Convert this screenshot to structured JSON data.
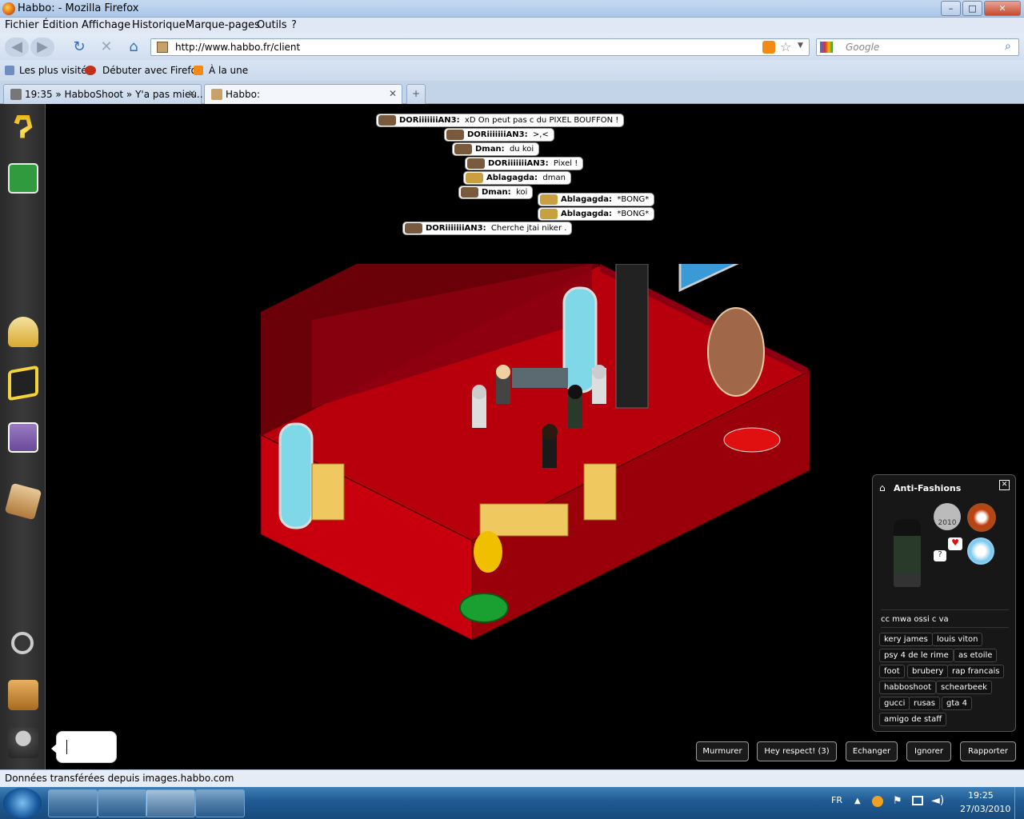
{
  "window": {
    "title": "Habbo: - Mozilla Firefox",
    "min": "–",
    "max": "□",
    "close": "✕"
  },
  "menu": [
    "Fichier",
    "Édition",
    "Affichage",
    "Historique",
    "Marque-pages",
    "Outils",
    "?"
  ],
  "nav": {
    "url": "http://www.habbo.fr/client",
    "search_placeholder": "Google"
  },
  "bookmarks": [
    "Les plus visités",
    "Débuter avec Firefox",
    "À la une"
  ],
  "tabs": [
    {
      "label": "19:35 » HabboShoot » Y'a pas mieu...",
      "close": "✕"
    },
    {
      "label": "Habbo:",
      "close": "✕"
    }
  ],
  "new_tab": "+",
  "chat": [
    {
      "name": "DORiiiiiiiAN3:",
      "text": "xD On peut pas c du PIXEL BOUFFON !"
    },
    {
      "name": "DORiiiiiiiAN3:",
      "text": ">,<"
    },
    {
      "name": "Dman:",
      "text": "du koi"
    },
    {
      "name": "DORiiiiiiiAN3:",
      "text": "Pixel !"
    },
    {
      "name": "Ablagagda:",
      "text": "dman"
    },
    {
      "name": "Dman:",
      "text": "koi"
    },
    {
      "name": "Ablagagda:",
      "text": "*BONG*"
    },
    {
      "name": "Ablagagda:",
      "text": "*BONG*"
    },
    {
      "name": "DORiiiiiiiAN3:",
      "text": "Cherche jtai niker ."
    }
  ],
  "profile": {
    "name": "Anti-Fashions",
    "close": "✕",
    "badge_year": "2010",
    "motto": "cc mwa ossi c va",
    "tags": [
      "kery james",
      "louis viton",
      "psy 4 de le rime",
      "as etoile",
      "foot",
      "brubery",
      "rap francais",
      "habboshoot",
      "schearbeek",
      "gucci",
      "rusas",
      "gta 4",
      "amigo de staff"
    ]
  },
  "actions": [
    "Murmurer",
    "Hey respect! (3)",
    "Echanger",
    "Ignorer",
    "Rapporter"
  ],
  "status": "Données transférées depuis images.habbo.com",
  "taskbar": {
    "lang": "FR",
    "time": "19:25",
    "date": "27/03/2010"
  },
  "colors": {
    "room_floor": "#b8000c",
    "room_wall": "#8a0010",
    "panel_bg": "#181818",
    "taskbar": "#1f5a92"
  }
}
